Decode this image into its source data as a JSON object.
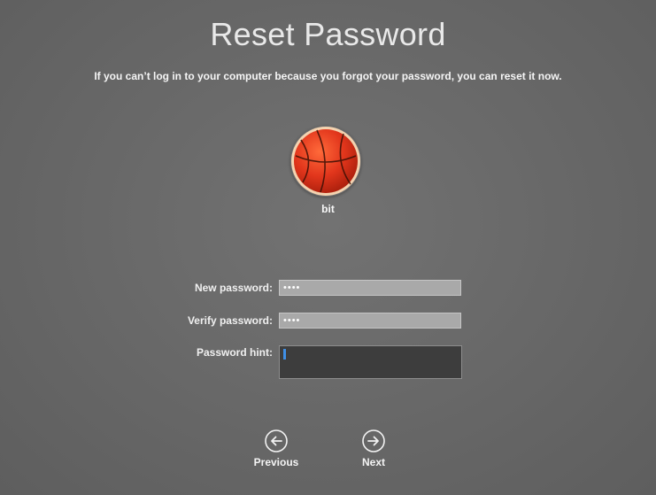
{
  "page": {
    "title": "Reset Password",
    "subtitle": "If you can’t log in to your computer because you forgot your password, you can reset it now."
  },
  "user": {
    "name": "bit",
    "avatar_icon": "basketball-icon"
  },
  "form": {
    "new_password_label": "New password:",
    "new_password_value": "••••",
    "verify_password_label": "Verify password:",
    "verify_password_value": "••••",
    "hint_label": "Password hint:",
    "hint_value": ""
  },
  "nav": {
    "previous_label": "Previous",
    "previous_icon": "arrow-left-icon",
    "next_label": "Next",
    "next_icon": "arrow-right-icon"
  },
  "colors": {
    "background": "#676767",
    "field_background": "#a9a9a9",
    "hint_background": "#3d3d3d",
    "caret": "#3f8fe6",
    "ball": "#e2361c"
  }
}
